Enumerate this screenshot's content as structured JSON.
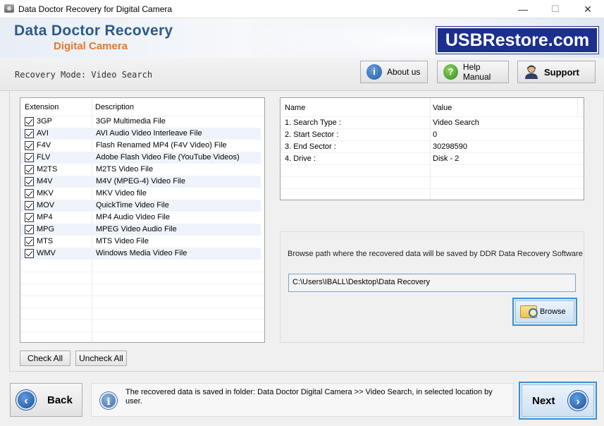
{
  "window": {
    "title": "Data Doctor Recovery for Digital Camera",
    "minimize": "—",
    "maximize": "☐",
    "close": "✕"
  },
  "header": {
    "brand_main": "Data Doctor Recovery",
    "brand_sub": "Digital Camera",
    "badge": "USBRestore.com"
  },
  "toolbar": {
    "mode_label": "Recovery Mode: Video Search",
    "about_label": "About us",
    "help_label": "Help Manual",
    "support_label": "Support"
  },
  "extensions": {
    "col_extension": "Extension",
    "col_description": "Description",
    "rows": [
      {
        "ext": "3GP",
        "desc": "3GP Multimedia File",
        "checked": true
      },
      {
        "ext": "AVI",
        "desc": "AVI Audio Video Interleave File",
        "checked": true
      },
      {
        "ext": "F4V",
        "desc": "Flash Renamed MP4 (F4V Video) File",
        "checked": true
      },
      {
        "ext": "FLV",
        "desc": "Adobe Flash Video File (YouTube Videos)",
        "checked": true
      },
      {
        "ext": "M2TS",
        "desc": "M2TS Video File",
        "checked": true
      },
      {
        "ext": "M4V",
        "desc": "M4V (MPEG-4) Video File",
        "checked": true
      },
      {
        "ext": "MKV",
        "desc": "MKV Video file",
        "checked": true
      },
      {
        "ext": "MOV",
        "desc": "QuickTime Video File",
        "checked": true
      },
      {
        "ext": "MP4",
        "desc": "MP4 Audio Video File",
        "checked": true
      },
      {
        "ext": "MPG",
        "desc": "MPEG Video Audio File",
        "checked": true
      },
      {
        "ext": "MTS",
        "desc": "MTS Video File",
        "checked": true
      },
      {
        "ext": "WMV",
        "desc": "Windows Media Video File",
        "checked": true
      }
    ],
    "check_all": "Check All",
    "uncheck_all": "Uncheck All"
  },
  "info": {
    "col_name": "Name",
    "col_value": "Value",
    "rows": [
      {
        "name": "1. Search Type :",
        "value": "Video Search"
      },
      {
        "name": "2. Start Sector :",
        "value": "0"
      },
      {
        "name": "3. End Sector :",
        "value": "30298590"
      },
      {
        "name": "4. Drive :",
        "value": "Disk - 2"
      }
    ]
  },
  "save": {
    "prompt": "Browse path where the recovered data will be saved by DDR Data Recovery Software",
    "path": "C:\\Users\\IBALL\\Desktop\\Data Recovery",
    "browse_label": "Browse"
  },
  "footer": {
    "back_label": "Back",
    "next_label": "Next",
    "status": "The recovered data is saved in folder: Data Doctor Digital Camera  >> Video Search, in selected location by user."
  },
  "colors": {
    "brand_blue": "#2c5a8a",
    "brand_orange": "#e5782a",
    "badge_bg": "#1b2f8f",
    "focus_border": "#3d8fd0"
  }
}
